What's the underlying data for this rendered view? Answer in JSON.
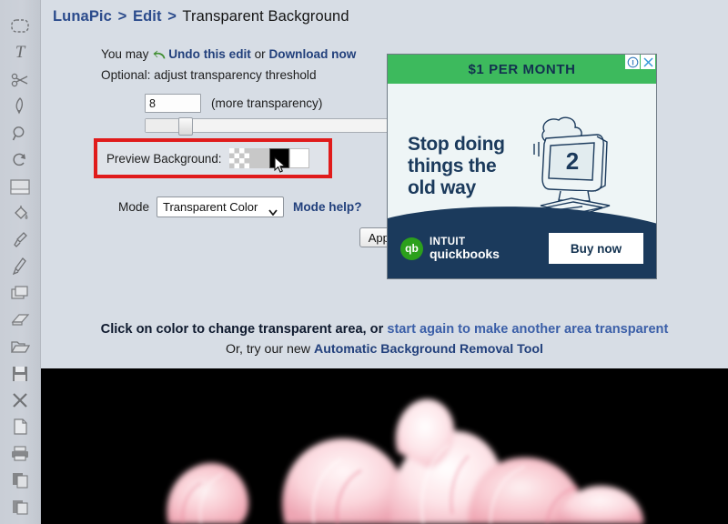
{
  "app": {
    "name": "LunaPic Photo Editor",
    "background_color": "#d7dde5"
  },
  "toolbar": {
    "items": [
      {
        "name": "select-tool",
        "icon": "marquee-select-icon"
      },
      {
        "name": "text-tool",
        "icon": "text-T-icon",
        "glyph": "T"
      },
      {
        "name": "scissors-tool",
        "icon": "scissors-icon"
      },
      {
        "name": "pen-tool",
        "icon": "pen-icon"
      },
      {
        "name": "zoom-tool",
        "icon": "magnifier-icon"
      },
      {
        "name": "rotate-tool",
        "icon": "rotate-refresh-icon"
      },
      {
        "name": "border-tool",
        "icon": "border-rectangle-icon"
      },
      {
        "name": "fill-tool",
        "icon": "paint-bucket-icon"
      },
      {
        "name": "eyedropper-tool",
        "icon": "eyedropper-icon"
      },
      {
        "name": "brush-tool",
        "icon": "paintbrush-icon"
      },
      {
        "name": "layers-tool",
        "icon": "layers-icon"
      },
      {
        "name": "eraser-tool",
        "icon": "eraser-icon"
      },
      {
        "name": "open-file",
        "icon": "folder-open-icon"
      },
      {
        "name": "save-file",
        "icon": "floppy-save-icon"
      },
      {
        "name": "close-file",
        "icon": "x-close-icon"
      },
      {
        "name": "new-file",
        "icon": "page-document-icon"
      },
      {
        "name": "print",
        "icon": "printer-icon"
      },
      {
        "name": "copy",
        "icon": "copy-pages-icon"
      },
      {
        "name": "paste",
        "icon": "paste-clipboard-icon"
      }
    ]
  },
  "breadcrumb": {
    "root": "LunaPic",
    "sep": ">",
    "section": "Edit",
    "current": "Transparent Background"
  },
  "form": {
    "intro_prefix": "You may ",
    "undo_label": "Undo this edit",
    "intro_middle": " or ",
    "download_label": "Download now",
    "optional_text": "Optional: adjust transparency threshold",
    "threshold_value": "8",
    "threshold_hint": "(more transparency)",
    "slider": {
      "value": 8,
      "min": 0,
      "max": 100,
      "percent": 13
    },
    "preview_background_label": "Preview Background:",
    "swatches": [
      {
        "name": "swatch-transparent",
        "label": "transparent",
        "kind": "checker",
        "selected": false
      },
      {
        "name": "swatch-gray",
        "label": "gray",
        "color": "#c8c8c8",
        "kind": "gray",
        "selected": false
      },
      {
        "name": "swatch-black",
        "label": "black",
        "color": "#000000",
        "kind": "black",
        "selected": true
      },
      {
        "name": "swatch-white",
        "label": "white",
        "color": "#ffffff",
        "kind": "white",
        "selected": false
      }
    ],
    "highlight_color": "#e01b1b",
    "mode_label": "Mode",
    "mode_selected": "Transparent Color",
    "mode_options": [
      "Transparent Color"
    ],
    "mode_help_label": "Mode help?",
    "apply_label": "Apply"
  },
  "ad": {
    "banner_text": "$1 PER MONTH",
    "headline_line1": "Stop doing",
    "headline_line2": "things the",
    "headline_line3": "old way",
    "illustration_number": "2",
    "brand_logo_text": "qb",
    "brand_line1": "INTUIT",
    "brand_line2": "quickbooks",
    "cta_label": "Buy now",
    "info_icon": "info-circle-icon",
    "close_icon": "close-x-icon",
    "banner_color": "#3dba5d",
    "footer_color": "#1b3a5c"
  },
  "footer": {
    "line1_strong": "Click on color to change transparent area, or ",
    "line1_link": "start again to make another area transparent",
    "line2_prefix": "Or, try our new ",
    "line2_link": "Automatic Background Removal Tool"
  },
  "canvas": {
    "background_color": "#000000",
    "subject": "pink rose petals"
  }
}
